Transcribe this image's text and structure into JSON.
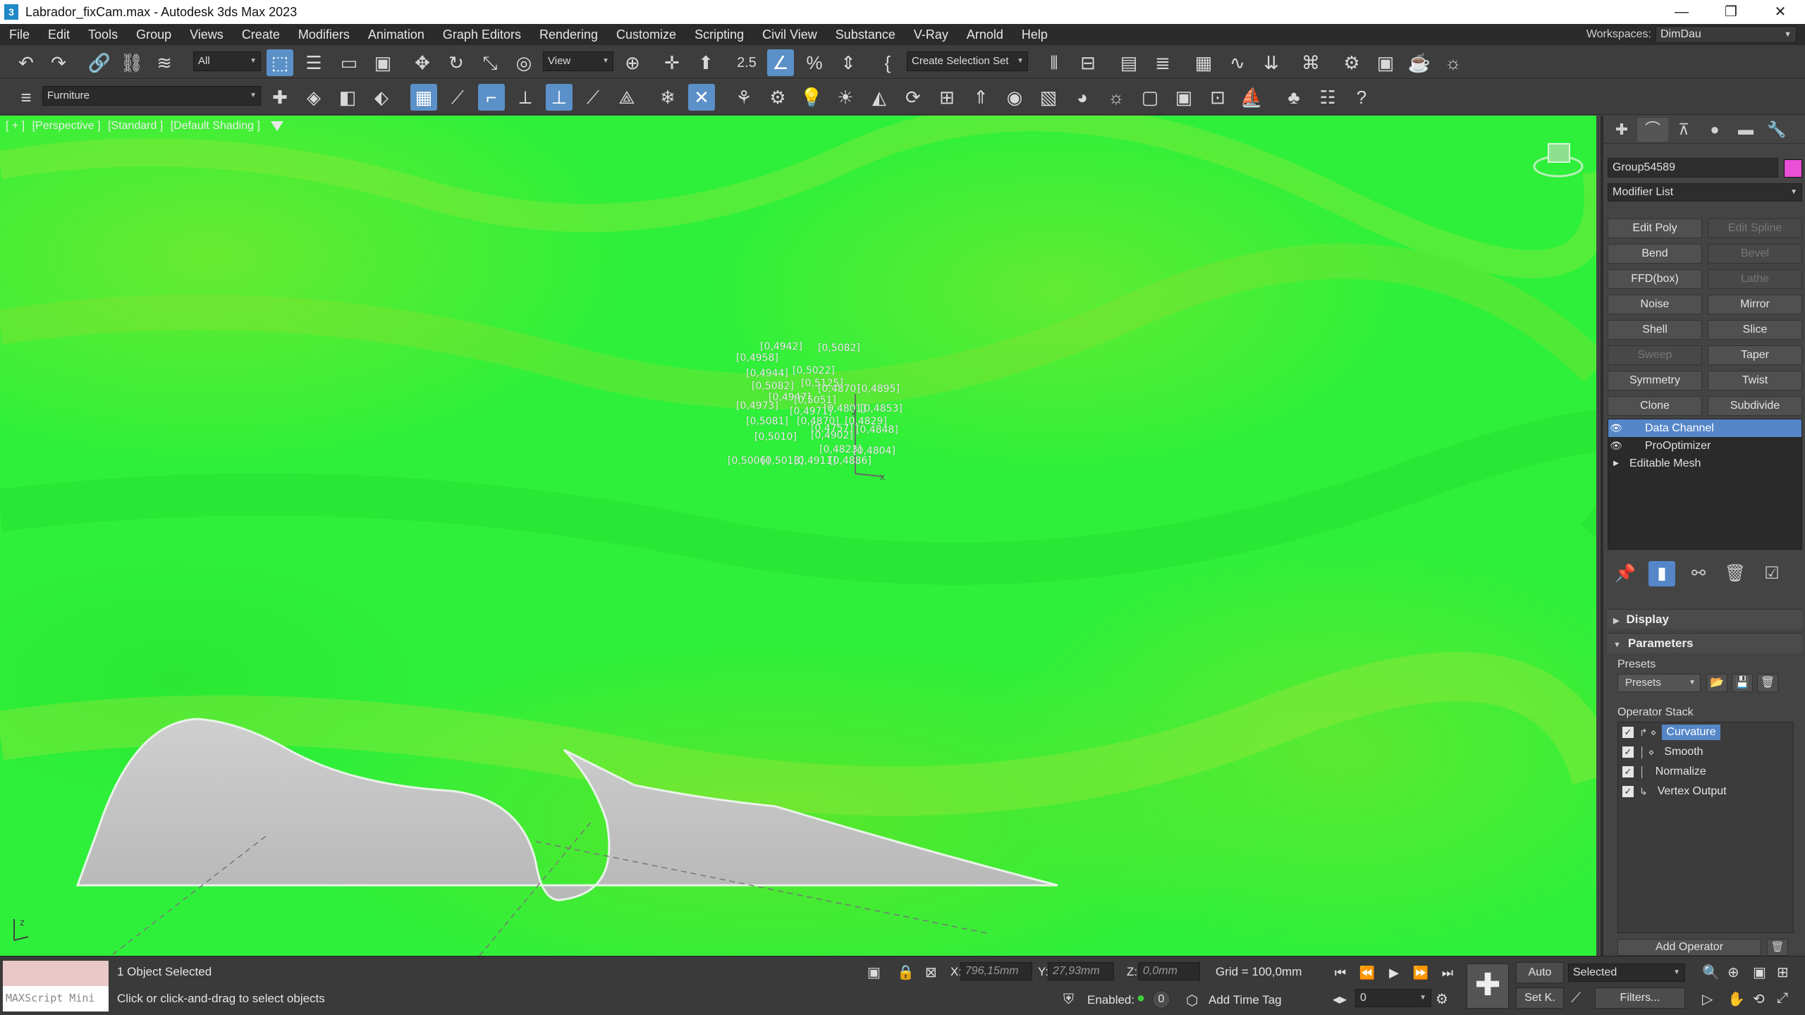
{
  "window": {
    "title": "Labrador_fixCam.max - Autodesk 3ds Max 2023",
    "app_icon_text": "3",
    "minimize": "—",
    "maximize": "❐",
    "close": "✕"
  },
  "menu": {
    "items": [
      "File",
      "Edit",
      "Tools",
      "Group",
      "Views",
      "Create",
      "Modifiers",
      "Animation",
      "Graph Editors",
      "Rendering",
      "Customize",
      "Scripting",
      "Civil View",
      "Substance",
      "V-Ray",
      "Arnold",
      "Help"
    ],
    "workspaces_label": "Workspaces:",
    "workspaces_value": "DimDau"
  },
  "toolbar": {
    "selection_filter": "All",
    "ref_coord": "View",
    "named_selection": "Create Selection Set",
    "snap_label": "2.5",
    "layer_name": "Furniture"
  },
  "viewport": {
    "labels": [
      "[ + ]",
      "[Perspective ]",
      "[Standard ]",
      "[Default Shading ]"
    ],
    "data_labels": [
      "[0,4942]",
      "[0,5082]",
      "[0,4958]",
      "[0,4944]",
      "[0,5022]",
      "[0,5082]",
      "[0,5125]",
      "[0,4870]",
      "[0,4895]",
      "[0,4947]",
      "[0,5051]",
      "[0,4973]",
      "[0,4971]",
      "[0,4801]",
      "[0,4853]",
      "[0,5081]",
      "[0,4870]",
      "[0,4829]",
      "[0,4757]",
      "[0,4848]",
      "[0,5010]",
      "[0,4902]",
      "[0,4823]",
      "[0,4804]",
      "[0,5006]",
      "[0,5018]",
      "[0,4911]",
      "[0,4886]"
    ],
    "axis_z": "z",
    "axis_x": "x",
    "corner_axis": "z"
  },
  "command_panel": {
    "object_name": "Group54589",
    "object_color": "#ea4fd8",
    "modifier_list": "Modifier List",
    "modifier_buttons": [
      {
        "label": "Edit Poly",
        "enabled": true
      },
      {
        "label": "Edit Spline",
        "enabled": false
      },
      {
        "label": "Bend",
        "enabled": true
      },
      {
        "label": "Bevel",
        "enabled": false
      },
      {
        "label": "FFD(box)",
        "enabled": true
      },
      {
        "label": "Lathe",
        "enabled": false
      },
      {
        "label": "Noise",
        "enabled": true
      },
      {
        "label": "Mirror",
        "enabled": true
      },
      {
        "label": "Shell",
        "enabled": true
      },
      {
        "label": "Slice",
        "enabled": true
      },
      {
        "label": "Sweep",
        "enabled": false
      },
      {
        "label": "Taper",
        "enabled": true
      },
      {
        "label": "Symmetry",
        "enabled": true
      },
      {
        "label": "Twist",
        "enabled": true
      },
      {
        "label": "Clone",
        "enabled": true
      },
      {
        "label": "Subdivide",
        "enabled": true
      }
    ],
    "stack": {
      "data_channel": "Data Channel",
      "pro_optimizer": "ProOptimizer",
      "editable_mesh": "Editable Mesh"
    },
    "rollout_display": "Display",
    "rollout_parameters": "Parameters",
    "presets_label": "Presets",
    "presets_value": "Presets",
    "operator_stack_label": "Operator Stack",
    "operators": {
      "curvature": "Curvature",
      "smooth": "Smooth",
      "normalize": "Normalize",
      "vertex_output": "Vertex Output"
    },
    "add_operator": "Add Operator"
  },
  "status": {
    "maxscript_label": "MAXScript Mini",
    "selection_info": "1 Object Selected",
    "prompt": "Click or click-and-drag to select objects",
    "x_label": "X:",
    "x_value": "796,15mm",
    "y_label": "Y:",
    "y_value": "27,93mm",
    "z_label": "Z:",
    "z_value": "0,0mm",
    "grid": "Grid = 100,0mm",
    "enabled_label": "Enabled:",
    "enabled_value": "0",
    "add_time_tag": "Add Time Tag",
    "auto": "Auto",
    "set_k": "Set K.",
    "selected": "Selected",
    "frame": "0",
    "filters": "Filters..."
  }
}
